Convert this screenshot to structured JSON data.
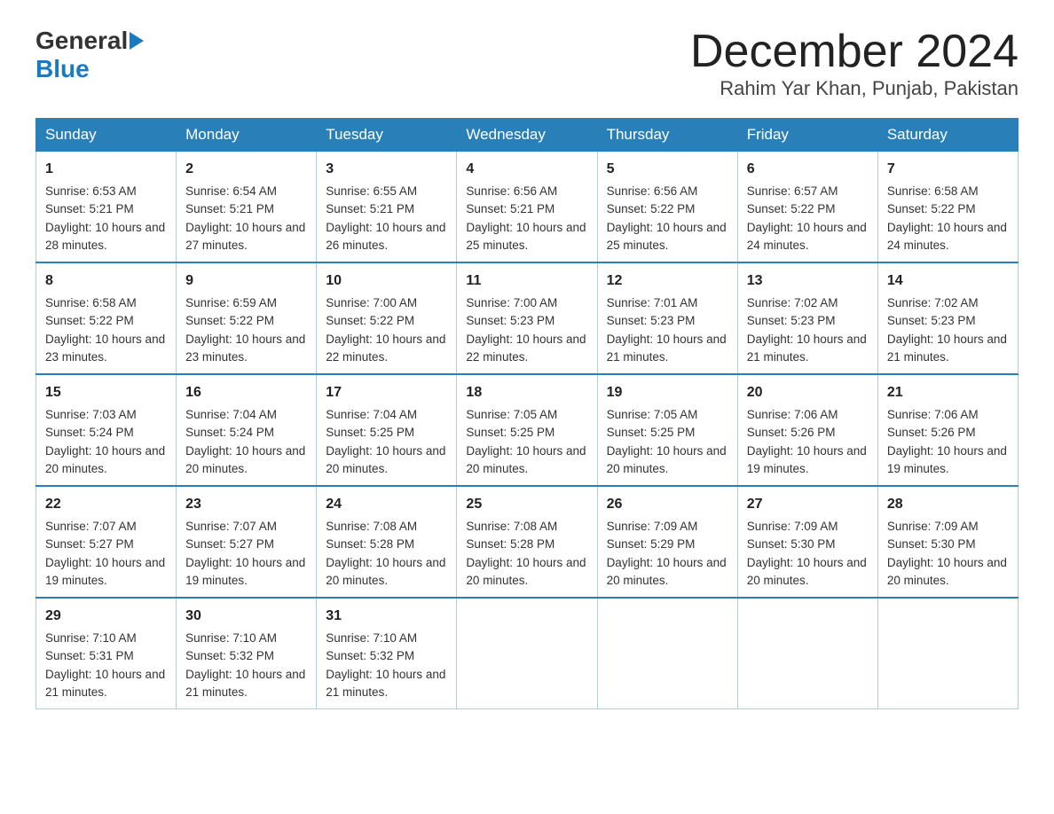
{
  "header": {
    "logo_general": "General",
    "logo_blue": "Blue",
    "month_title": "December 2024",
    "location": "Rahim Yar Khan, Punjab, Pakistan"
  },
  "weekdays": [
    "Sunday",
    "Monday",
    "Tuesday",
    "Wednesday",
    "Thursday",
    "Friday",
    "Saturday"
  ],
  "weeks": [
    [
      {
        "day": "1",
        "sunrise": "6:53 AM",
        "sunset": "5:21 PM",
        "daylight": "10 hours and 28 minutes."
      },
      {
        "day": "2",
        "sunrise": "6:54 AM",
        "sunset": "5:21 PM",
        "daylight": "10 hours and 27 minutes."
      },
      {
        "day": "3",
        "sunrise": "6:55 AM",
        "sunset": "5:21 PM",
        "daylight": "10 hours and 26 minutes."
      },
      {
        "day": "4",
        "sunrise": "6:56 AM",
        "sunset": "5:21 PM",
        "daylight": "10 hours and 25 minutes."
      },
      {
        "day": "5",
        "sunrise": "6:56 AM",
        "sunset": "5:22 PM",
        "daylight": "10 hours and 25 minutes."
      },
      {
        "day": "6",
        "sunrise": "6:57 AM",
        "sunset": "5:22 PM",
        "daylight": "10 hours and 24 minutes."
      },
      {
        "day": "7",
        "sunrise": "6:58 AM",
        "sunset": "5:22 PM",
        "daylight": "10 hours and 24 minutes."
      }
    ],
    [
      {
        "day": "8",
        "sunrise": "6:58 AM",
        "sunset": "5:22 PM",
        "daylight": "10 hours and 23 minutes."
      },
      {
        "day": "9",
        "sunrise": "6:59 AM",
        "sunset": "5:22 PM",
        "daylight": "10 hours and 23 minutes."
      },
      {
        "day": "10",
        "sunrise": "7:00 AM",
        "sunset": "5:22 PM",
        "daylight": "10 hours and 22 minutes."
      },
      {
        "day": "11",
        "sunrise": "7:00 AM",
        "sunset": "5:23 PM",
        "daylight": "10 hours and 22 minutes."
      },
      {
        "day": "12",
        "sunrise": "7:01 AM",
        "sunset": "5:23 PM",
        "daylight": "10 hours and 21 minutes."
      },
      {
        "day": "13",
        "sunrise": "7:02 AM",
        "sunset": "5:23 PM",
        "daylight": "10 hours and 21 minutes."
      },
      {
        "day": "14",
        "sunrise": "7:02 AM",
        "sunset": "5:23 PM",
        "daylight": "10 hours and 21 minutes."
      }
    ],
    [
      {
        "day": "15",
        "sunrise": "7:03 AM",
        "sunset": "5:24 PM",
        "daylight": "10 hours and 20 minutes."
      },
      {
        "day": "16",
        "sunrise": "7:04 AM",
        "sunset": "5:24 PM",
        "daylight": "10 hours and 20 minutes."
      },
      {
        "day": "17",
        "sunrise": "7:04 AM",
        "sunset": "5:25 PM",
        "daylight": "10 hours and 20 minutes."
      },
      {
        "day": "18",
        "sunrise": "7:05 AM",
        "sunset": "5:25 PM",
        "daylight": "10 hours and 20 minutes."
      },
      {
        "day": "19",
        "sunrise": "7:05 AM",
        "sunset": "5:25 PM",
        "daylight": "10 hours and 20 minutes."
      },
      {
        "day": "20",
        "sunrise": "7:06 AM",
        "sunset": "5:26 PM",
        "daylight": "10 hours and 19 minutes."
      },
      {
        "day": "21",
        "sunrise": "7:06 AM",
        "sunset": "5:26 PM",
        "daylight": "10 hours and 19 minutes."
      }
    ],
    [
      {
        "day": "22",
        "sunrise": "7:07 AM",
        "sunset": "5:27 PM",
        "daylight": "10 hours and 19 minutes."
      },
      {
        "day": "23",
        "sunrise": "7:07 AM",
        "sunset": "5:27 PM",
        "daylight": "10 hours and 19 minutes."
      },
      {
        "day": "24",
        "sunrise": "7:08 AM",
        "sunset": "5:28 PM",
        "daylight": "10 hours and 20 minutes."
      },
      {
        "day": "25",
        "sunrise": "7:08 AM",
        "sunset": "5:28 PM",
        "daylight": "10 hours and 20 minutes."
      },
      {
        "day": "26",
        "sunrise": "7:09 AM",
        "sunset": "5:29 PM",
        "daylight": "10 hours and 20 minutes."
      },
      {
        "day": "27",
        "sunrise": "7:09 AM",
        "sunset": "5:30 PM",
        "daylight": "10 hours and 20 minutes."
      },
      {
        "day": "28",
        "sunrise": "7:09 AM",
        "sunset": "5:30 PM",
        "daylight": "10 hours and 20 minutes."
      }
    ],
    [
      {
        "day": "29",
        "sunrise": "7:10 AM",
        "sunset": "5:31 PM",
        "daylight": "10 hours and 21 minutes."
      },
      {
        "day": "30",
        "sunrise": "7:10 AM",
        "sunset": "5:32 PM",
        "daylight": "10 hours and 21 minutes."
      },
      {
        "day": "31",
        "sunrise": "7:10 AM",
        "sunset": "5:32 PM",
        "daylight": "10 hours and 21 minutes."
      },
      null,
      null,
      null,
      null
    ]
  ],
  "labels": {
    "sunrise": "Sunrise:",
    "sunset": "Sunset:",
    "daylight": "Daylight:"
  }
}
